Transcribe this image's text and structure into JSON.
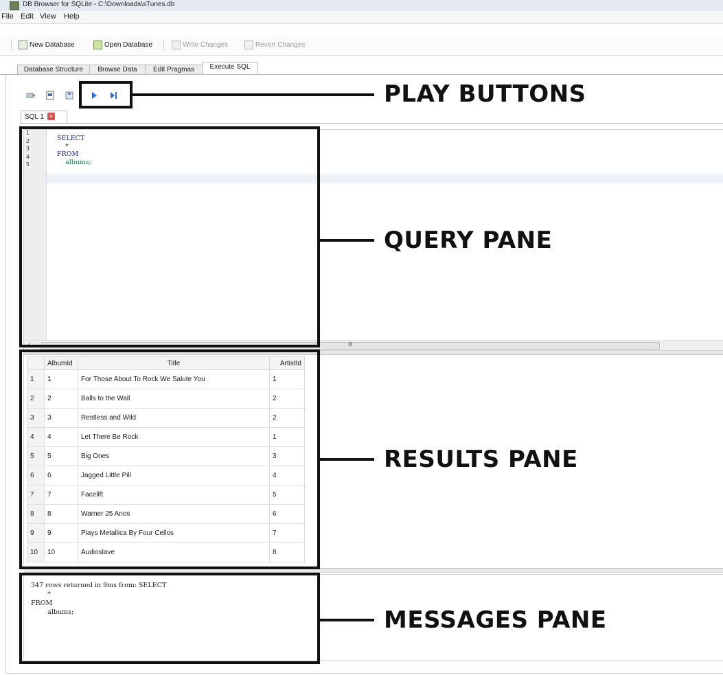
{
  "window": {
    "title": "DB Browser for SQLite - C:\\Downloads\\sTunes.db"
  },
  "menu": [
    "File",
    "Edit",
    "View",
    "Help"
  ],
  "toolbar": {
    "new_database": "New Database",
    "open_database": "Open Database",
    "write_changes": "Write Changes",
    "revert_changes": "Revert Changes"
  },
  "tabs": [
    "Database Structure",
    "Browse Data",
    "Edit Pragmas",
    "Execute SQL"
  ],
  "active_tab": "Execute SQL",
  "sql_tab": {
    "label": "SQL 1",
    "close": "×"
  },
  "editor": {
    "line_numbers": [
      "1",
      "2",
      "3",
      "4",
      "5"
    ],
    "lines": [
      {
        "text": "SELECT",
        "kind": "keyword"
      },
      {
        "text": "    *",
        "kind": "plain"
      },
      {
        "text": "FROM",
        "kind": "keyword"
      },
      {
        "text": "    albums;",
        "kind": "identifier"
      },
      {
        "text": "",
        "kind": "plain"
      }
    ],
    "scroll_left": "‹",
    "scroll_grip": "III"
  },
  "results": {
    "columns": [
      "AlbumId",
      "Title",
      "ArtistId"
    ],
    "rows": [
      {
        "n": "1",
        "id": "1",
        "title": "For Those About To Rock We Salute You",
        "artist": "1"
      },
      {
        "n": "2",
        "id": "2",
        "title": "Balls to the Wall",
        "artist": "2"
      },
      {
        "n": "3",
        "id": "3",
        "title": "Restless and Wild",
        "artist": "2"
      },
      {
        "n": "4",
        "id": "4",
        "title": "Let There Be Rock",
        "artist": "1"
      },
      {
        "n": "5",
        "id": "5",
        "title": "Big Ones",
        "artist": "3"
      },
      {
        "n": "6",
        "id": "6",
        "title": "Jagged Little Pill",
        "artist": "4"
      },
      {
        "n": "7",
        "id": "7",
        "title": "Facelift",
        "artist": "5"
      },
      {
        "n": "8",
        "id": "8",
        "title": "Warner 25 Anos",
        "artist": "6"
      },
      {
        "n": "9",
        "id": "9",
        "title": "Plays Metallica By Four Cellos",
        "artist": "7"
      },
      {
        "n": "10",
        "id": "10",
        "title": "Audioslave",
        "artist": "8"
      }
    ]
  },
  "messages": {
    "text": "347 rows returned in 9ms from: SELECT\n        *\nFROM\n        albums;"
  },
  "callouts": {
    "play": "PLAY BUTTONS",
    "query": "QUERY PANE",
    "results": "RESULTS PANE",
    "messages": "MESSAGES PANE"
  },
  "colors": {
    "keyword": "#1d2a86",
    "identifier": "#1f7a4a",
    "play_icon": "#2b6fd6",
    "close_icon": "#d9534f",
    "callout": "#111111"
  }
}
